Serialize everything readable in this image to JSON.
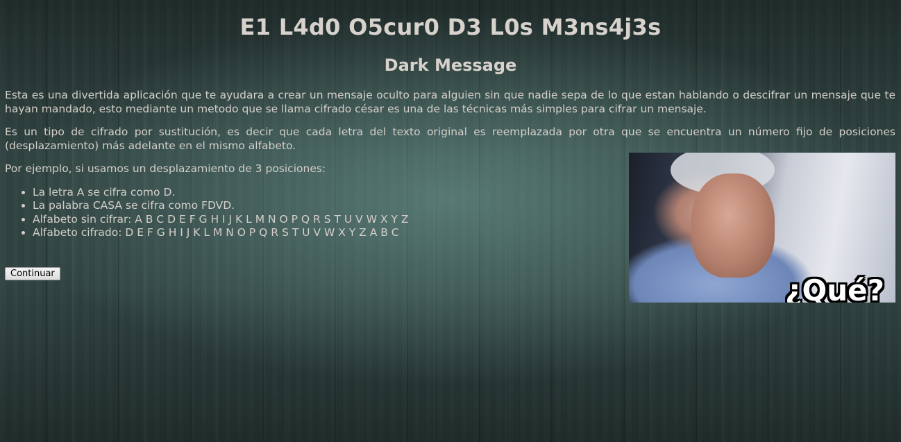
{
  "header": {
    "title": "E1 L4d0 O5cur0 D3 L0s M3ns4j3s",
    "subtitle": "Dark Message"
  },
  "intro": {
    "p1": "Esta es una divertida aplicación que te ayudara a crear un mensaje oculto para alguien sin que nadie sepa de lo que estan hablando o descifrar un mensaje que te hayan mandado, esto mediante un metodo que se llama cifrado césar es una de las técnicas más simples para cifrar un mensaje.",
    "p2": "Es un tipo de cifrado por sustitución, es decir que cada letra del texto original es reemplazada por otra que se encuentra un número fijo de posiciones (desplazamiento) más adelante en el mismo alfabeto.",
    "p3": "Por ejemplo, si usamos un desplazamiento de 3 posiciones:"
  },
  "examples": [
    "La letra A se cifra como D.",
    "La palabra CASA se cifra como FDVD.",
    "Alfabeto sin cifrar: A B C D E F G H I J K L M N O P Q R S T U V W X Y Z",
    "Alfabeto cifrado: D E F G H I J K L M N O P Q R S T U V W X Y Z A B C"
  ],
  "meme": {
    "caption": "¿Qué?"
  },
  "actions": {
    "continue_label": "Continuar"
  }
}
